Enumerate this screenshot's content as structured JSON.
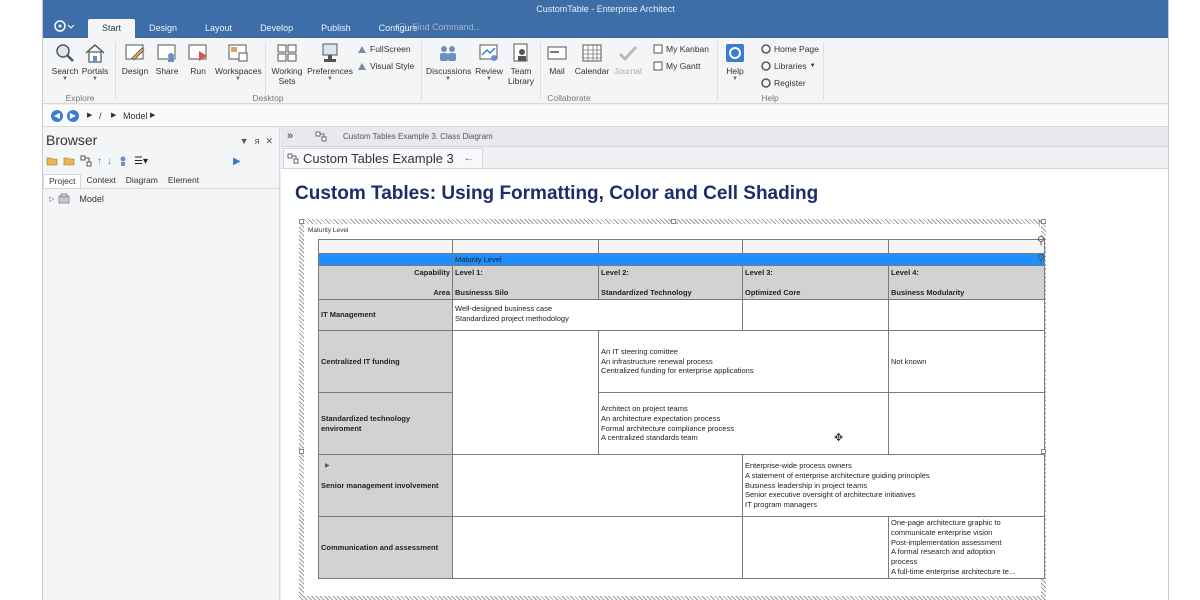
{
  "window": {
    "title": "CustomTable - Enterprise Architect"
  },
  "menu_tabs": [
    "Start",
    "Design",
    "Layout",
    "Develop",
    "Publish",
    "Configure"
  ],
  "find_placeholder": "Find Command...",
  "ribbon": {
    "explore": {
      "label": "Explore",
      "search": "Search",
      "portals": "Portals"
    },
    "desktop": {
      "label": "Desktop",
      "design": "Design",
      "share": "Share",
      "run": "Run",
      "workspaces": "Workspaces",
      "working_sets_1": "Working",
      "working_sets_2": "Sets",
      "preferences": "Preferences",
      "fullscreen": "FullScreen",
      "visual_style": "Visual Style"
    },
    "collaborate": {
      "label": "Collaborate",
      "discussions": "Discussions",
      "review": "Review",
      "team_library_1": "Team",
      "team_library_2": "Library",
      "mail": "Mail",
      "calendar": "Calendar",
      "journal": "Journal",
      "my_kanban": "My Kanban",
      "my_gantt": "My Gantt"
    },
    "help": {
      "label": "Help",
      "help": "Help",
      "home_page": "Home Page",
      "libraries": "Libraries",
      "register": "Register"
    }
  },
  "navbar": {
    "separator": "/",
    "path": "Model"
  },
  "browser": {
    "title": "Browser",
    "tabs": [
      "Project",
      "Context",
      "Diagram",
      "Element"
    ],
    "tree_item": "Model"
  },
  "diagram": {
    "breadcrumb": "Custom Tables Example 3.  Class Diagram",
    "tab_name": "Custom Tables Example 3",
    "title": "Custom Tables: Using Formatting, Color and Cell Shading",
    "element_label": "Maturity Level"
  },
  "table": {
    "maturity_header": "Maturity Level",
    "capability": "Capability",
    "area": "Area",
    "levels": [
      {
        "level": "Level 1:",
        "name": "Businesss Silo"
      },
      {
        "level": "Level 2:",
        "name": "Standardized Technology"
      },
      {
        "level": "Level 3:",
        "name": "Optimized Core"
      },
      {
        "level": "Level 4:",
        "name": "Business Modularity"
      }
    ],
    "rows": {
      "it_management": {
        "label": "IT Management",
        "l1_1": "Well-designed business case",
        "l1_2": "Standardized project methodology"
      },
      "centralized_funding": {
        "label": "Centralized IT funding",
        "l2_1": "An IT steering comittee",
        "l2_2": "An infrastructure renewal process",
        "l2_3": "Centralized funding for enterprise applications",
        "l4": "Not known"
      },
      "std_tech": {
        "label_1": "Standardized technology",
        "label_2": "enviroment",
        "l2_1": "Architect on project teams",
        "l2_2": "An architecture expectation process",
        "l2_3": "Formal architecture compliance process",
        "l2_4": "A centralized standards team"
      },
      "senior_mgmt": {
        "label": "Senior management involvement",
        "l3_1": "Enterprise-wide process owners",
        "l3_2": "A statement of enterprise architecture guiding principles",
        "l3_3": "Business leadership in project teams",
        "l3_4": "Senior executive oversight of architecture initiatives",
        "l3_5": "IT program managers"
      },
      "comm_assess": {
        "label": "Communication and assessment",
        "l4_1": "One-page architecture graphic to",
        "l4_2": "communicate enterprise vision",
        "l4_3": "Post-implementation assessment",
        "l4_4": "A formal research and adoption",
        "l4_5": "process",
        "l4_6": "A full-time enterprise architecture te..."
      }
    }
  }
}
